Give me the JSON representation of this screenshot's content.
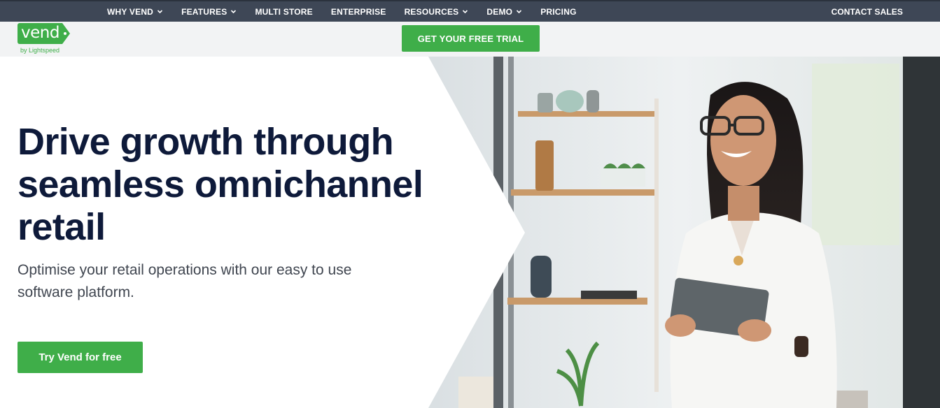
{
  "nav": {
    "items": [
      {
        "label": "WHY VEND",
        "has_dropdown": true
      },
      {
        "label": "FEATURES",
        "has_dropdown": true
      },
      {
        "label": "MULTI STORE",
        "has_dropdown": false
      },
      {
        "label": "ENTERPRISE",
        "has_dropdown": false
      },
      {
        "label": "RESOURCES",
        "has_dropdown": true
      },
      {
        "label": "DEMO",
        "has_dropdown": true
      },
      {
        "label": "PRICING",
        "has_dropdown": false
      }
    ],
    "contact_label": "CONTACT SALES"
  },
  "brand": {
    "logo_text": "vend",
    "logo_sub": "by Lightspeed",
    "trial_label": "GET YOUR FREE TRIAL"
  },
  "hero": {
    "headline": "Drive growth through seamless omnichannel retail",
    "subcopy": "Optimise your retail operations with our easy to use software platform.",
    "cta_label": "Try Vend for free",
    "image_alt": "smiling-woman-holding-tablet-in-store"
  },
  "colors": {
    "topbar": "#3e4756",
    "accent_green": "#3fae49",
    "headline": "#0e1a3a",
    "body_text": "#404650"
  },
  "icons": {
    "dropdown": "chevron-down-icon"
  }
}
